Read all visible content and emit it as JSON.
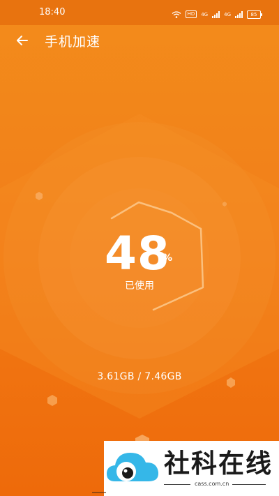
{
  "status_bar": {
    "time": "18:40",
    "hd_label": "HD",
    "signal_1": "4G",
    "signal_2": "4G",
    "battery": "85"
  },
  "toolbar": {
    "back_icon": "arrow-left-icon",
    "title": "手机加速"
  },
  "memory": {
    "percent_value": "48",
    "percent_unit": "%",
    "percent_used": 48,
    "used_label": "已使用",
    "usage_text": "3.61GB / 7.46GB"
  },
  "watermark": {
    "text": "社科在线",
    "domain": "cass.com.cn"
  },
  "colors": {
    "background_top": "#f38c1b",
    "background_bottom": "#ee6a0a",
    "status_bar": "#e8730f",
    "text": "#ffffff"
  }
}
